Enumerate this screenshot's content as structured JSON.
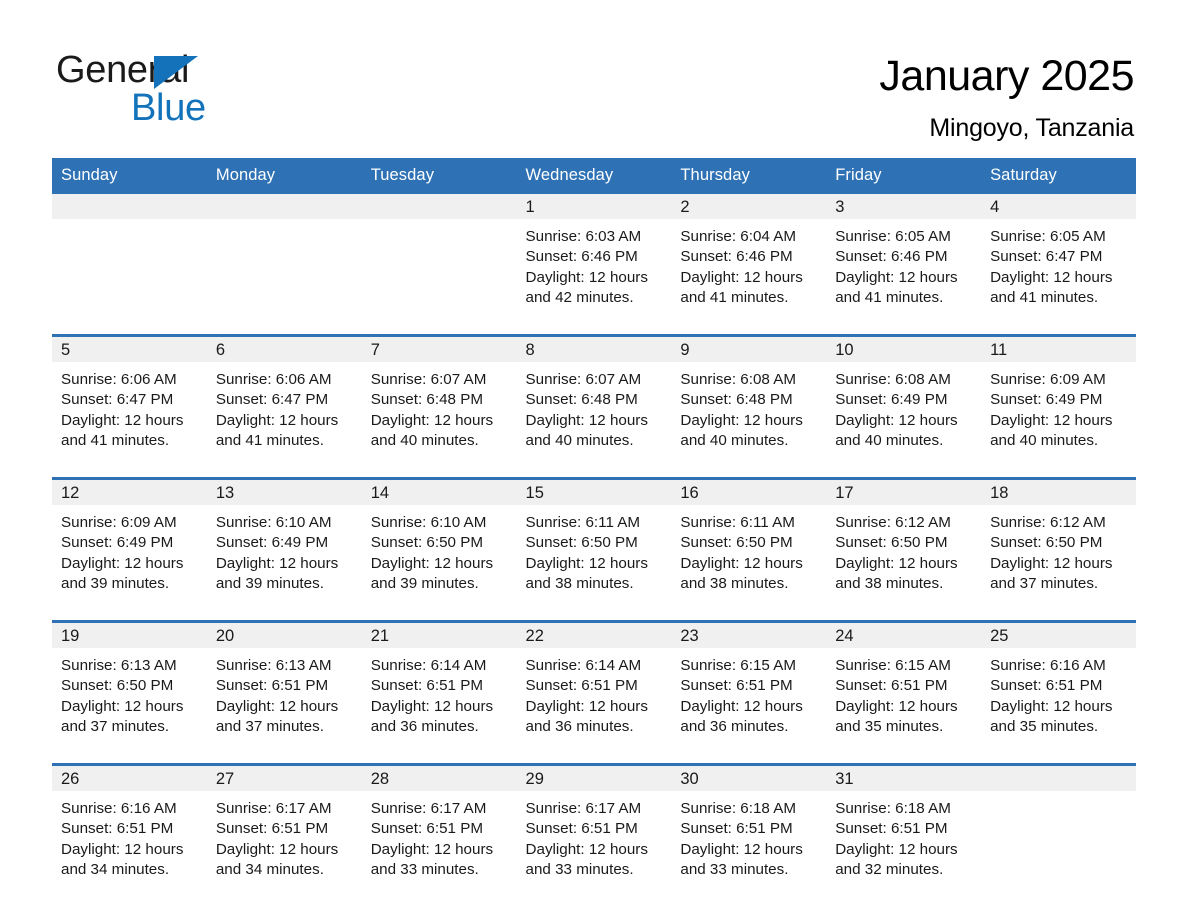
{
  "brand": {
    "word_one": "General",
    "word_two": "Blue",
    "triangle_icon": "triangle-icon"
  },
  "header": {
    "title": "January 2025",
    "subtitle": "Mingoyo, Tanzania"
  },
  "colors": {
    "header_blue": "#2E71B4",
    "brand_blue": "#1272BA",
    "day_band_gray": "#F0F0F0",
    "text": "#1a1a1a"
  },
  "weekday_headers": [
    "Sunday",
    "Monday",
    "Tuesday",
    "Wednesday",
    "Thursday",
    "Friday",
    "Saturday"
  ],
  "weeks": [
    [
      {
        "day": "",
        "sunrise": "",
        "sunset": "",
        "daylight_line1": "",
        "daylight_line2": "",
        "empty": true
      },
      {
        "day": "",
        "sunrise": "",
        "sunset": "",
        "daylight_line1": "",
        "daylight_line2": "",
        "empty": true
      },
      {
        "day": "",
        "sunrise": "",
        "sunset": "",
        "daylight_line1": "",
        "daylight_line2": "",
        "empty": true
      },
      {
        "day": "1",
        "sunrise": "Sunrise: 6:03 AM",
        "sunset": "Sunset: 6:46 PM",
        "daylight_line1": "Daylight: 12 hours",
        "daylight_line2": "and 42 minutes.",
        "empty": false
      },
      {
        "day": "2",
        "sunrise": "Sunrise: 6:04 AM",
        "sunset": "Sunset: 6:46 PM",
        "daylight_line1": "Daylight: 12 hours",
        "daylight_line2": "and 41 minutes.",
        "empty": false
      },
      {
        "day": "3",
        "sunrise": "Sunrise: 6:05 AM",
        "sunset": "Sunset: 6:46 PM",
        "daylight_line1": "Daylight: 12 hours",
        "daylight_line2": "and 41 minutes.",
        "empty": false
      },
      {
        "day": "4",
        "sunrise": "Sunrise: 6:05 AM",
        "sunset": "Sunset: 6:47 PM",
        "daylight_line1": "Daylight: 12 hours",
        "daylight_line2": "and 41 minutes.",
        "empty": false
      }
    ],
    [
      {
        "day": "5",
        "sunrise": "Sunrise: 6:06 AM",
        "sunset": "Sunset: 6:47 PM",
        "daylight_line1": "Daylight: 12 hours",
        "daylight_line2": "and 41 minutes.",
        "empty": false
      },
      {
        "day": "6",
        "sunrise": "Sunrise: 6:06 AM",
        "sunset": "Sunset: 6:47 PM",
        "daylight_line1": "Daylight: 12 hours",
        "daylight_line2": "and 41 minutes.",
        "empty": false
      },
      {
        "day": "7",
        "sunrise": "Sunrise: 6:07 AM",
        "sunset": "Sunset: 6:48 PM",
        "daylight_line1": "Daylight: 12 hours",
        "daylight_line2": "and 40 minutes.",
        "empty": false
      },
      {
        "day": "8",
        "sunrise": "Sunrise: 6:07 AM",
        "sunset": "Sunset: 6:48 PM",
        "daylight_line1": "Daylight: 12 hours",
        "daylight_line2": "and 40 minutes.",
        "empty": false
      },
      {
        "day": "9",
        "sunrise": "Sunrise: 6:08 AM",
        "sunset": "Sunset: 6:48 PM",
        "daylight_line1": "Daylight: 12 hours",
        "daylight_line2": "and 40 minutes.",
        "empty": false
      },
      {
        "day": "10",
        "sunrise": "Sunrise: 6:08 AM",
        "sunset": "Sunset: 6:49 PM",
        "daylight_line1": "Daylight: 12 hours",
        "daylight_line2": "and 40 minutes.",
        "empty": false
      },
      {
        "day": "11",
        "sunrise": "Sunrise: 6:09 AM",
        "sunset": "Sunset: 6:49 PM",
        "daylight_line1": "Daylight: 12 hours",
        "daylight_line2": "and 40 minutes.",
        "empty": false
      }
    ],
    [
      {
        "day": "12",
        "sunrise": "Sunrise: 6:09 AM",
        "sunset": "Sunset: 6:49 PM",
        "daylight_line1": "Daylight: 12 hours",
        "daylight_line2": "and 39 minutes.",
        "empty": false
      },
      {
        "day": "13",
        "sunrise": "Sunrise: 6:10 AM",
        "sunset": "Sunset: 6:49 PM",
        "daylight_line1": "Daylight: 12 hours",
        "daylight_line2": "and 39 minutes.",
        "empty": false
      },
      {
        "day": "14",
        "sunrise": "Sunrise: 6:10 AM",
        "sunset": "Sunset: 6:50 PM",
        "daylight_line1": "Daylight: 12 hours",
        "daylight_line2": "and 39 minutes.",
        "empty": false
      },
      {
        "day": "15",
        "sunrise": "Sunrise: 6:11 AM",
        "sunset": "Sunset: 6:50 PM",
        "daylight_line1": "Daylight: 12 hours",
        "daylight_line2": "and 38 minutes.",
        "empty": false
      },
      {
        "day": "16",
        "sunrise": "Sunrise: 6:11 AM",
        "sunset": "Sunset: 6:50 PM",
        "daylight_line1": "Daylight: 12 hours",
        "daylight_line2": "and 38 minutes.",
        "empty": false
      },
      {
        "day": "17",
        "sunrise": "Sunrise: 6:12 AM",
        "sunset": "Sunset: 6:50 PM",
        "daylight_line1": "Daylight: 12 hours",
        "daylight_line2": "and 38 minutes.",
        "empty": false
      },
      {
        "day": "18",
        "sunrise": "Sunrise: 6:12 AM",
        "sunset": "Sunset: 6:50 PM",
        "daylight_line1": "Daylight: 12 hours",
        "daylight_line2": "and 37 minutes.",
        "empty": false
      }
    ],
    [
      {
        "day": "19",
        "sunrise": "Sunrise: 6:13 AM",
        "sunset": "Sunset: 6:50 PM",
        "daylight_line1": "Daylight: 12 hours",
        "daylight_line2": "and 37 minutes.",
        "empty": false
      },
      {
        "day": "20",
        "sunrise": "Sunrise: 6:13 AM",
        "sunset": "Sunset: 6:51 PM",
        "daylight_line1": "Daylight: 12 hours",
        "daylight_line2": "and 37 minutes.",
        "empty": false
      },
      {
        "day": "21",
        "sunrise": "Sunrise: 6:14 AM",
        "sunset": "Sunset: 6:51 PM",
        "daylight_line1": "Daylight: 12 hours",
        "daylight_line2": "and 36 minutes.",
        "empty": false
      },
      {
        "day": "22",
        "sunrise": "Sunrise: 6:14 AM",
        "sunset": "Sunset: 6:51 PM",
        "daylight_line1": "Daylight: 12 hours",
        "daylight_line2": "and 36 minutes.",
        "empty": false
      },
      {
        "day": "23",
        "sunrise": "Sunrise: 6:15 AM",
        "sunset": "Sunset: 6:51 PM",
        "daylight_line1": "Daylight: 12 hours",
        "daylight_line2": "and 36 minutes.",
        "empty": false
      },
      {
        "day": "24",
        "sunrise": "Sunrise: 6:15 AM",
        "sunset": "Sunset: 6:51 PM",
        "daylight_line1": "Daylight: 12 hours",
        "daylight_line2": "and 35 minutes.",
        "empty": false
      },
      {
        "day": "25",
        "sunrise": "Sunrise: 6:16 AM",
        "sunset": "Sunset: 6:51 PM",
        "daylight_line1": "Daylight: 12 hours",
        "daylight_line2": "and 35 minutes.",
        "empty": false
      }
    ],
    [
      {
        "day": "26",
        "sunrise": "Sunrise: 6:16 AM",
        "sunset": "Sunset: 6:51 PM",
        "daylight_line1": "Daylight: 12 hours",
        "daylight_line2": "and 34 minutes.",
        "empty": false
      },
      {
        "day": "27",
        "sunrise": "Sunrise: 6:17 AM",
        "sunset": "Sunset: 6:51 PM",
        "daylight_line1": "Daylight: 12 hours",
        "daylight_line2": "and 34 minutes.",
        "empty": false
      },
      {
        "day": "28",
        "sunrise": "Sunrise: 6:17 AM",
        "sunset": "Sunset: 6:51 PM",
        "daylight_line1": "Daylight: 12 hours",
        "daylight_line2": "and 33 minutes.",
        "empty": false
      },
      {
        "day": "29",
        "sunrise": "Sunrise: 6:17 AM",
        "sunset": "Sunset: 6:51 PM",
        "daylight_line1": "Daylight: 12 hours",
        "daylight_line2": "and 33 minutes.",
        "empty": false
      },
      {
        "day": "30",
        "sunrise": "Sunrise: 6:18 AM",
        "sunset": "Sunset: 6:51 PM",
        "daylight_line1": "Daylight: 12 hours",
        "daylight_line2": "and 33 minutes.",
        "empty": false
      },
      {
        "day": "31",
        "sunrise": "Sunrise: 6:18 AM",
        "sunset": "Sunset: 6:51 PM",
        "daylight_line1": "Daylight: 12 hours",
        "daylight_line2": "and 32 minutes.",
        "empty": false
      },
      {
        "day": "",
        "sunrise": "",
        "sunset": "",
        "daylight_line1": "",
        "daylight_line2": "",
        "empty": true
      }
    ]
  ]
}
